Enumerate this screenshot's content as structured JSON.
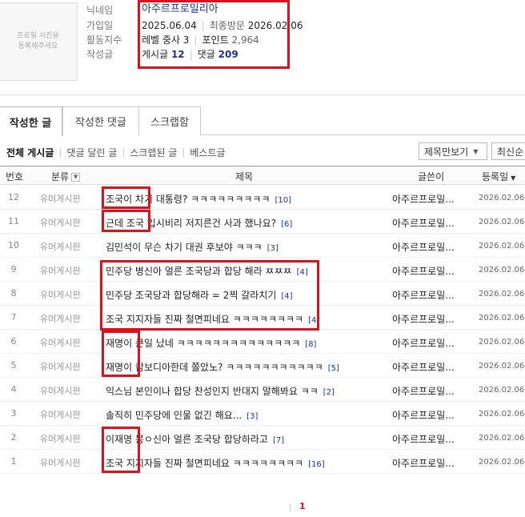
{
  "profile": {
    "photo_placeholder": "프로필 사진을\n등록해주세요",
    "labels": {
      "nickname": "닉네임",
      "joined": "가입일",
      "activity": "활동지수",
      "posts": "작성글"
    },
    "nickname": "아주르프로밀리아",
    "joined_date": "2025.06.04",
    "last_visit_label": "최종방문",
    "last_visit_date": "2026.02.06",
    "level": "레벨 중사 3",
    "points_label": "포인트",
    "points": "2,964",
    "posts_label": "게시글",
    "posts_count": "12",
    "comments_label": "댓글",
    "comments_count": "209"
  },
  "tabs": [
    {
      "label": "작성한 글",
      "active": true
    },
    {
      "label": "작성한 댓글",
      "active": false
    },
    {
      "label": "스크랩함",
      "active": false
    }
  ],
  "filters": [
    "전체 게시글",
    "댓글 달린 글",
    "스크랩된 글",
    "베스트글"
  ],
  "view_select": "제목만보기",
  "sort_select": "최신순",
  "table": {
    "headers": {
      "num": "번호",
      "category": "분류",
      "title": "제목",
      "author": "글쓴이",
      "date": "등록일"
    },
    "rows": [
      {
        "num": "12",
        "category": "유머게시판",
        "title": "조국이 차기 대통령? ㅋㅋㅋㅋㅋㅋㅋㅋㅋ",
        "comments": "[10]",
        "author": "아주르프로밀...",
        "date": "2026.02.06"
      },
      {
        "num": "11",
        "category": "유머게시판",
        "title": "근데 조국 입시비리 저지른건 사과 했나요?",
        "comments": "[6]",
        "author": "아주르프로밀...",
        "date": "2026.02.06"
      },
      {
        "num": "10",
        "category": "유머게시판",
        "title": "김민석이 무슨 차기 대권 후보야 ㅋㅋㅋ",
        "comments": "[3]",
        "author": "아주르프로밀...",
        "date": "2026.02.06"
      },
      {
        "num": "9",
        "category": "유머게시판",
        "title": "민주당 병신아 얼른 조국당과 합당 해라 ㅉㅉㅉ",
        "comments": "[4]",
        "author": "아주르프로밀...",
        "date": "2026.02.06"
      },
      {
        "num": "8",
        "category": "유머게시판",
        "title": "민주당 조국당과 합당해라 = 2찍 갈라치기",
        "comments": "[4]",
        "author": "아주르프로밀...",
        "date": "2026.02.06"
      },
      {
        "num": "7",
        "category": "유머게시판",
        "title": "조국 지지자들 진짜 철면피네요 ㅋㅋㅋㅋㅋㅋㅋㅋ",
        "comments": "[4]",
        "author": "아주르프로밀...",
        "date": "2026.02.06"
      },
      {
        "num": "6",
        "category": "유머게시판",
        "title": "재명이 큰일 났네 ㅋㅋㅋㅋㅋㅋㅋㅋㅋㅋㅋㅋㅋㅋ",
        "comments": "[8]",
        "author": "아주르프로밀...",
        "date": "2026.02.06"
      },
      {
        "num": "5",
        "category": "유머게시판",
        "title": "재명이 캄보디아한데 쫄았노? ㅋㅋㅋㅋㅋㅋㅋㅋㅋㅋㅋ",
        "comments": "[5]",
        "author": "아주르프로밀...",
        "date": "2026.02.06"
      },
      {
        "num": "4",
        "category": "유머게시판",
        "title": "익스님 본인이나 합당 찬성인지 반대지 말해봐요 ㅋㅋ",
        "comments": "[2]",
        "author": "아주르프로밀...",
        "date": "2026.02.06"
      },
      {
        "num": "3",
        "category": "유머게시판",
        "title": "솔직히 민주당에 인물 없긴 해요...",
        "comments": "[3]",
        "author": "아주르프로밀...",
        "date": "2026.02.06"
      },
      {
        "num": "2",
        "category": "유머게시판",
        "title": "이재명 봉ㅇ신아 얼른 조국당 합당하라고",
        "comments": "[7]",
        "author": "아주르프로밀...",
        "date": "2026.02.06"
      },
      {
        "num": "1",
        "category": "유머게시판",
        "title": "조국 지지자들 진짜 철면피네요 ㅋㅋㅋㅋㅋㅋㅋㅋ",
        "comments": "[16]",
        "author": "아주르프로밀...",
        "date": "2026.02.06"
      }
    ]
  },
  "pagination": {
    "current": "1"
  },
  "colors": {
    "annotation_red": "#e0101a",
    "link_blue": "#1a3391"
  },
  "icons": {
    "sort_toggle": "sort-toggle-icon",
    "dropdown": "chevron-down-icon",
    "sort_desc": "caret-down-icon"
  }
}
